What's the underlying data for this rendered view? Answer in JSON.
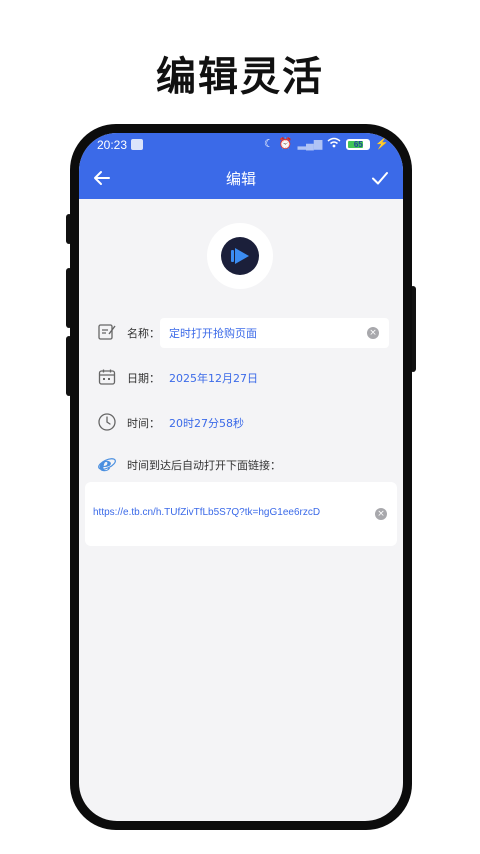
{
  "promo": {
    "headline": "编辑灵活"
  },
  "status_bar": {
    "time": "20:23",
    "battery": "65",
    "battery_level": 0.65
  },
  "app_bar": {
    "title": "编辑"
  },
  "form": {
    "name_label": "名称：",
    "name_value": "定时打开抢购页面",
    "date_label": "日期：",
    "date_value": "2025年12月27日",
    "time_label": "时间：",
    "time_value": "20时27分58秒",
    "link_label": "时间到达后自动打开下面链接：",
    "link_value": "https://e.tb.cn/h.TUfZivTfLb5S7Q?tk=hgG1ee6rzcD"
  },
  "colors": {
    "accent": "#3b6ae8",
    "background": "#f4f4f6",
    "battery_fill": "#43c556"
  },
  "icons": [
    "back-arrow-icon",
    "checkmark-icon",
    "play-icon",
    "edit-note-icon",
    "calendar-icon",
    "clock-icon",
    "internet-explorer-icon",
    "clear-icon",
    "moon-icon",
    "wifi-icon"
  ]
}
